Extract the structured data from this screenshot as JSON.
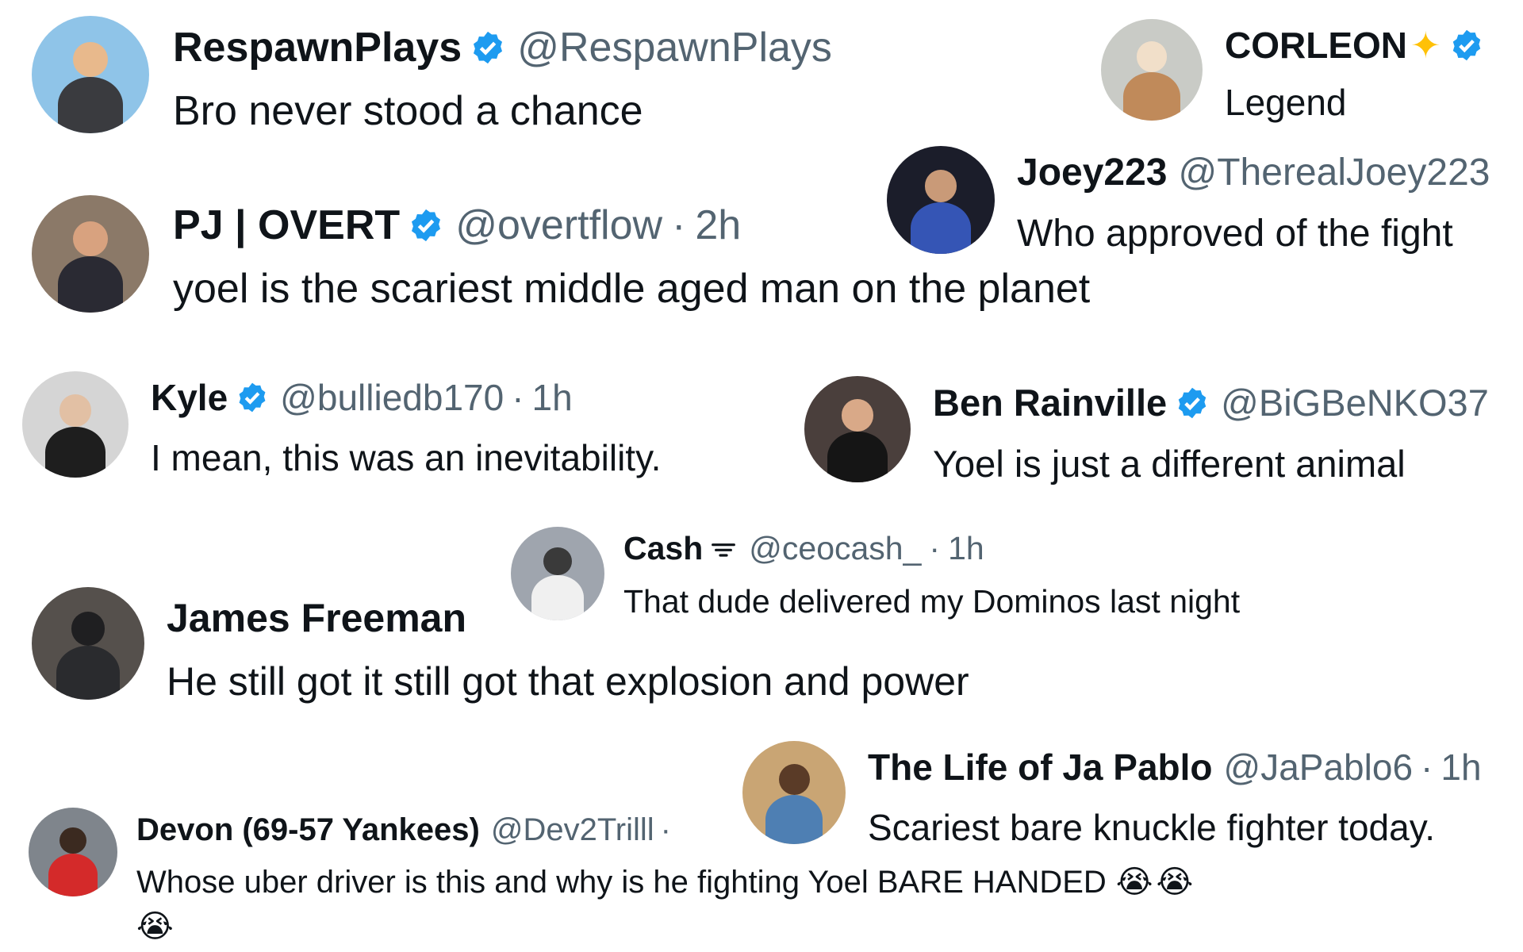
{
  "replies": [
    {
      "name": "RespawnPlays",
      "handle": "@RespawnPlays",
      "text": "Bro never stood a chance"
    },
    {
      "name": "CORLEON",
      "text": "Legend"
    },
    {
      "name": "Joey223",
      "handle": "@TherealJoey223",
      "text": "Who approved of the fight"
    },
    {
      "name": "PJ | OVERT",
      "handle": "@overtflow",
      "time": "2h",
      "text": "yoel is the scariest middle aged man on the planet"
    },
    {
      "name": "Kyle",
      "handle": "@bulliedb170",
      "time": "1h",
      "text": "I mean, this was an inevitability."
    },
    {
      "name": "Ben Rainville",
      "handle": "@BiGBeNKO37",
      "text": "Yoel is just a different animal"
    },
    {
      "name": "Cash",
      "handle": "@ceocash_",
      "time": "1h",
      "text": "That dude delivered my Dominos last night"
    },
    {
      "name": "James Freeman",
      "text": "He still got it still got that explosion and power"
    },
    {
      "name": "The Life of Ja Pablo",
      "handle": "@JaPablo6",
      "time": "1h",
      "text": "Scariest bare knuckle fighter today."
    },
    {
      "name": "Devon (69-57 Yankees)",
      "handle": "@Dev2Trilll",
      "text": "Whose uber driver is this and why is he fighting Yoel BARE HANDED",
      "emoji": "😭"
    }
  ],
  "separator": "·",
  "icons": {
    "verified": "verified-badge-icon",
    "sparkle": "sparkles-icon",
    "signal": "signal-icon"
  },
  "colors": {
    "verified": "#1d9bf0",
    "text": "#0f1419",
    "muted": "#536471"
  }
}
